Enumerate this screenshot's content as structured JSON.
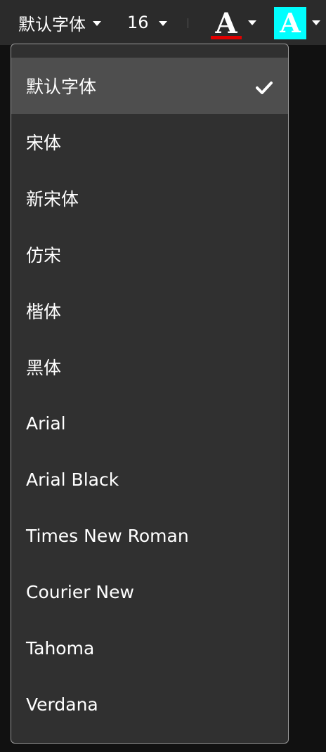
{
  "toolbar": {
    "font_family_value": "默认字体",
    "font_size_value": "16",
    "text_color_letter": "A",
    "highlight_color_letter": "A"
  },
  "colors": {
    "text_color": "#e00000",
    "highlight_color": "#00ffff",
    "toolbar_bg": "#2b2b2b",
    "menu_bg": "#303030",
    "selected_bg": "#4e4e4e"
  },
  "font_menu": {
    "items": [
      {
        "label": "默认字体",
        "selected": true,
        "icon": "check-icon"
      },
      {
        "label": "宋体",
        "selected": false
      },
      {
        "label": "新宋体",
        "selected": false
      },
      {
        "label": "仿宋",
        "selected": false
      },
      {
        "label": "楷体",
        "selected": false
      },
      {
        "label": "黑体",
        "selected": false
      },
      {
        "label": "Arial",
        "selected": false
      },
      {
        "label": "Arial Black",
        "selected": false
      },
      {
        "label": "Times New Roman",
        "selected": false
      },
      {
        "label": "Courier New",
        "selected": false
      },
      {
        "label": "Tahoma",
        "selected": false
      },
      {
        "label": "Verdana",
        "selected": false
      }
    ]
  }
}
